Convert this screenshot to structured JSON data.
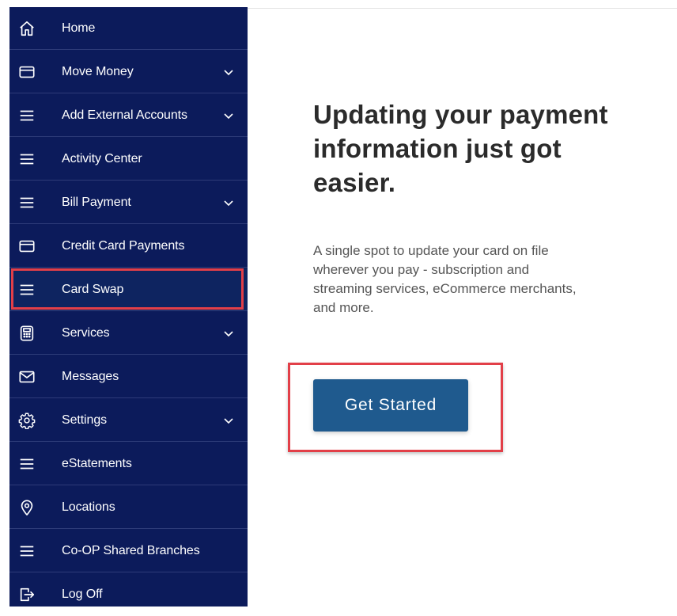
{
  "sidebar": {
    "items": [
      {
        "label": "Home",
        "icon": "home-icon"
      },
      {
        "label": "Move Money",
        "icon": "card-icon",
        "has_dropdown": true
      },
      {
        "label": "Add External Accounts",
        "icon": "menu-icon",
        "has_dropdown": true
      },
      {
        "label": "Activity Center",
        "icon": "menu-icon"
      },
      {
        "label": "Bill Payment",
        "icon": "menu-icon",
        "has_dropdown": true
      },
      {
        "label": "Credit Card Payments",
        "icon": "card-icon"
      },
      {
        "label": "Card Swap",
        "icon": "menu-icon",
        "active": true
      },
      {
        "label": "Services",
        "icon": "calculator-icon",
        "has_dropdown": true
      },
      {
        "label": "Messages",
        "icon": "envelope-icon"
      },
      {
        "label": "Settings",
        "icon": "gear-icon",
        "has_dropdown": true
      },
      {
        "label": "eStatements",
        "icon": "menu-icon"
      },
      {
        "label": "Locations",
        "icon": "location-pin-icon"
      },
      {
        "label": "Co-OP Shared Branches",
        "icon": "menu-icon"
      },
      {
        "label": "Log Off",
        "icon": "logout-icon"
      }
    ]
  },
  "main": {
    "headline_lines": [
      "Updating your payment",
      "information just got",
      "easier."
    ],
    "description_lines": [
      "A single spot to update your card on file",
      "wherever you pay - subscription and",
      "streaming services, eCommerce merchants,",
      "and more."
    ],
    "cta_label": "Get Started"
  },
  "colors": {
    "sidebar_bg": "#0c1b5b",
    "cta_bg": "#1f5a8e",
    "highlight": "#e23f48"
  }
}
